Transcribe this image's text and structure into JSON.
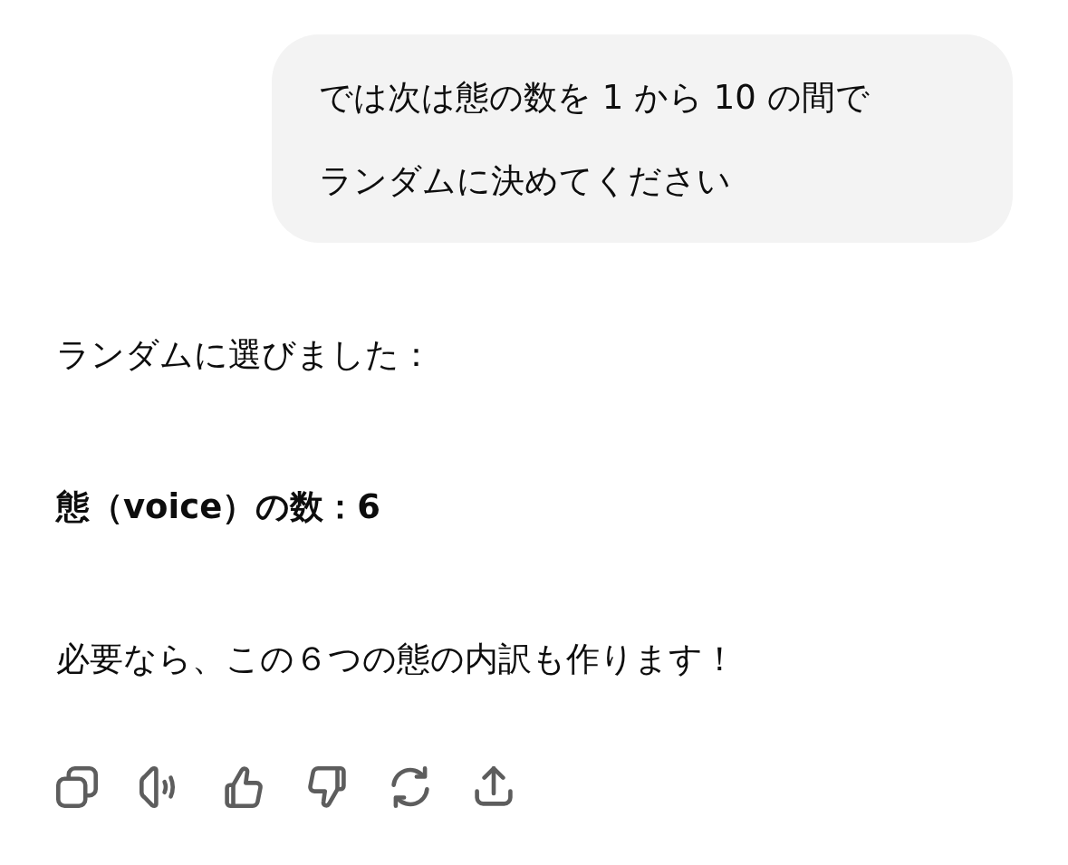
{
  "user_message": {
    "lines": [
      "では次は態の数を 1 から 10 の間で",
      "ランダムに決めてください"
    ]
  },
  "assistant_message": {
    "paragraphs": [
      {
        "kind": "plain",
        "text": "ランダムに選びました："
      },
      {
        "kind": "bold",
        "text": "態（voice）の数：6"
      },
      {
        "kind": "plain",
        "text": "必要なら、この６つの態の内訳も作ります！"
      }
    ]
  }
}
